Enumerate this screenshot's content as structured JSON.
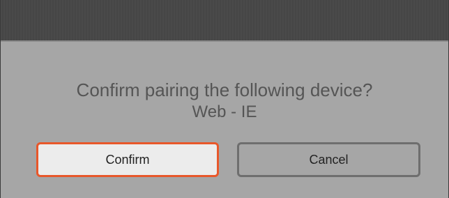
{
  "dialog": {
    "message": "Confirm pairing the following device?",
    "device_name": "Web - IE",
    "confirm_label": "Confirm",
    "cancel_label": "Cancel"
  },
  "colors": {
    "confirm_border": "#e8572a",
    "cancel_border": "#6e6e6e",
    "background": "#a6a6a6",
    "top_bar": "#484848"
  }
}
